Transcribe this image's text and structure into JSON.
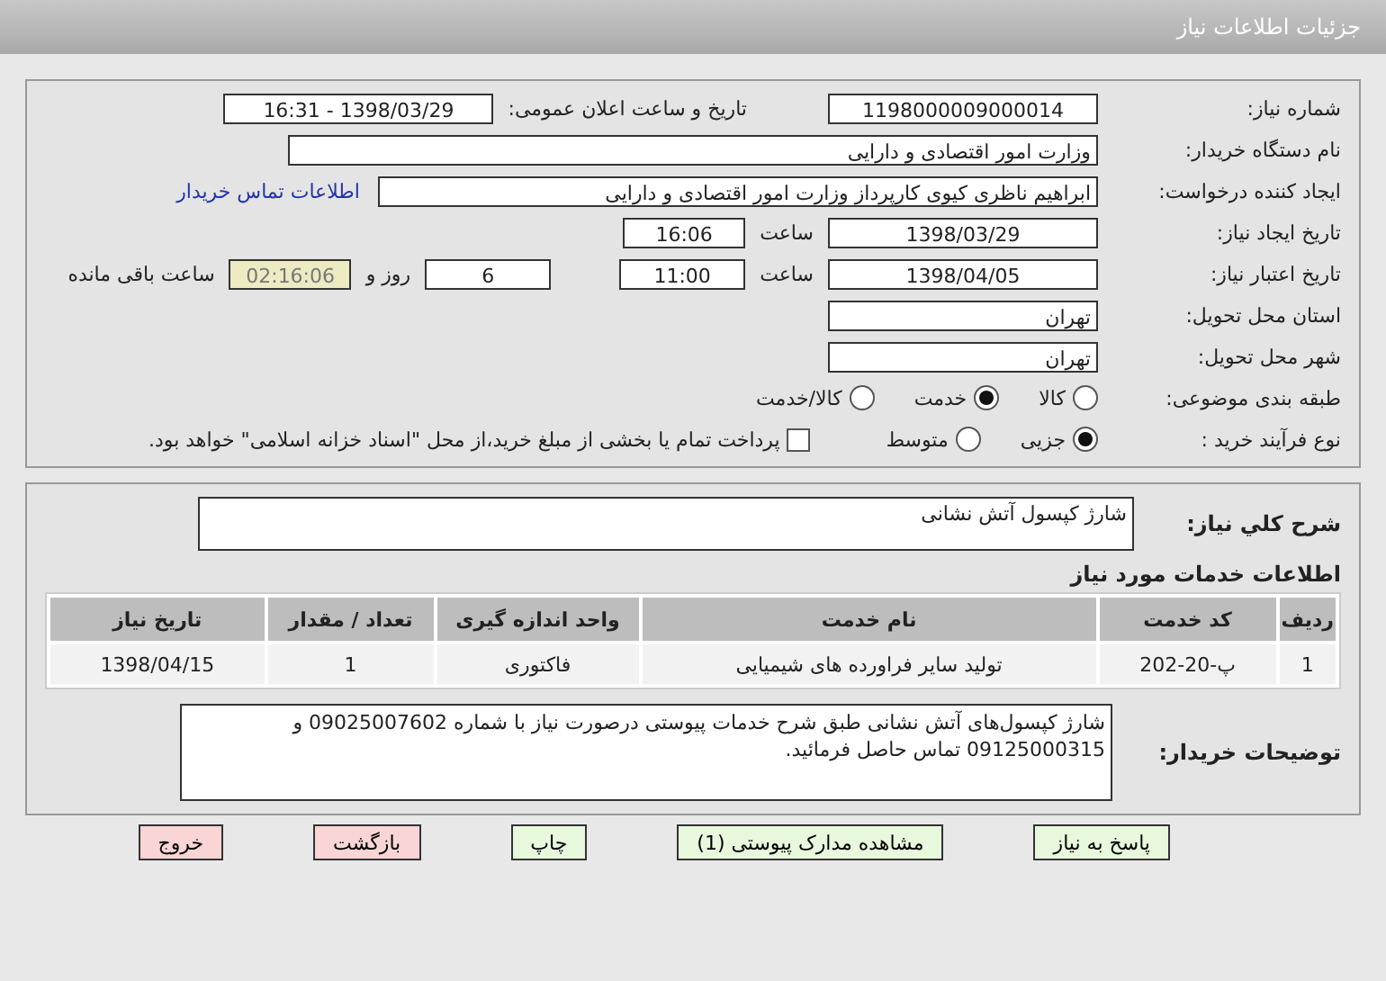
{
  "header": {
    "title": "جزئیات اطلاعات نیاز"
  },
  "details": {
    "need_number": {
      "label": "شماره نیاز:",
      "value": "1198000009000014"
    },
    "announce": {
      "label": "تاریخ و ساعت اعلان عمومی:",
      "value": "1398/03/29 - 16:31"
    },
    "buyer_org": {
      "label": "نام دستگاه خریدار:",
      "value": "وزارت امور اقتصادی و دارایی"
    },
    "requester": {
      "label": "ایجاد کننده درخواست:",
      "value": "ابراهیم  ناظری کیوی کارپرداز وزارت امور اقتصادی و دارایی",
      "link": "اطلاعات تماس خریدار"
    },
    "creation": {
      "label": "تاریخ ایجاد نیاز:",
      "date": "1398/03/29",
      "time_label": "ساعت",
      "time": "16:06"
    },
    "validity": {
      "label": "تاریخ اعتبار نیاز:",
      "date": "1398/04/05",
      "time_label": "ساعت",
      "time": "11:00",
      "days": "6",
      "days_label": "روز و",
      "remaining": "02:16:06",
      "remaining_label": "ساعت باقی مانده"
    },
    "province": {
      "label": "استان محل تحویل:",
      "value": "تهران"
    },
    "city": {
      "label": "شهر محل تحویل:",
      "value": "تهران"
    },
    "category": {
      "label": "طبقه بندی موضوعی:",
      "options": [
        {
          "label": "کالا",
          "selected": false
        },
        {
          "label": "خدمت",
          "selected": true
        },
        {
          "label": "کالا/خدمت",
          "selected": false
        }
      ]
    },
    "purchase_type": {
      "label": "نوع فرآیند خرید :",
      "options": [
        {
          "label": "جزیی",
          "selected": true
        },
        {
          "label": "متوسط",
          "selected": false
        }
      ],
      "payment": {
        "checked": false,
        "label": "پرداخت تمام یا بخشی از مبلغ خرید،از محل \"اسناد خزانه اسلامی\" خواهد بود."
      }
    }
  },
  "summary": {
    "label": "شرح کلي نياز:",
    "value": "شارژ کپسول آتش نشانی"
  },
  "services": {
    "title": "اطلاعات خدمات مورد نیاز",
    "columns": [
      "ردیف",
      "کد خدمت",
      "نام خدمت",
      "واحد اندازه گیری",
      "تعداد / مقدار",
      "تاریخ نیاز"
    ],
    "rows": [
      [
        "1",
        "پ-20-202",
        "تولید سایر فراورده های شیمیایی",
        "فاکتوری",
        "1",
        "1398/04/15"
      ]
    ]
  },
  "notes": {
    "label": "توضیحات خریدار:",
    "value": "شارژ کپسول‌های آتش نشانی طبق شرح خدمات پیوستی درصورت نیاز با شماره 09025007602 و 09125000315 تماس حاصل فرمائید."
  },
  "buttons": [
    {
      "label": "پاسخ به نیاز",
      "kind": "green"
    },
    {
      "label": "مشاهده مدارک پیوستی (1)",
      "kind": "green"
    },
    {
      "label": "چاپ",
      "kind": "green"
    },
    {
      "label": "بازگشت",
      "kind": "red"
    },
    {
      "label": "خروج",
      "kind": "red"
    }
  ]
}
